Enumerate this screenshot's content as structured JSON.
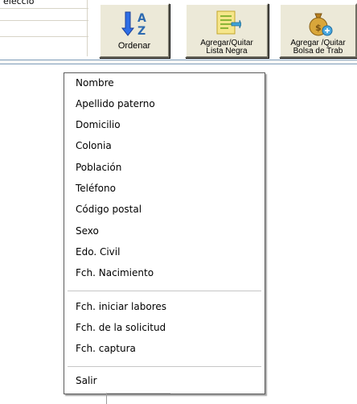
{
  "window": {
    "title_fragment": "elecció"
  },
  "toolbar": {
    "sort_label": "Ordenar",
    "blacklist_label": "Agregar/Quitar\nLista Negra",
    "jobbag_label": "Agregar /Quitar\nBolsa de Trab"
  },
  "context_menu": {
    "group1": [
      "Nombre",
      "Apellido paterno",
      "Domicilio",
      "Colonia",
      "Población",
      "Teléfono",
      "Código postal",
      "Sexo",
      "Edo. Civil",
      "Fch. Nacimiento"
    ],
    "group2": [
      "Fch. iniciar labores",
      "Fch. de la solicitud",
      "Fch. captura"
    ],
    "exit_label": "Salir"
  },
  "colors": {
    "button_face": "#ece9d8",
    "menu_border": "#5b5b5b",
    "separator": "#c6c6c6"
  }
}
